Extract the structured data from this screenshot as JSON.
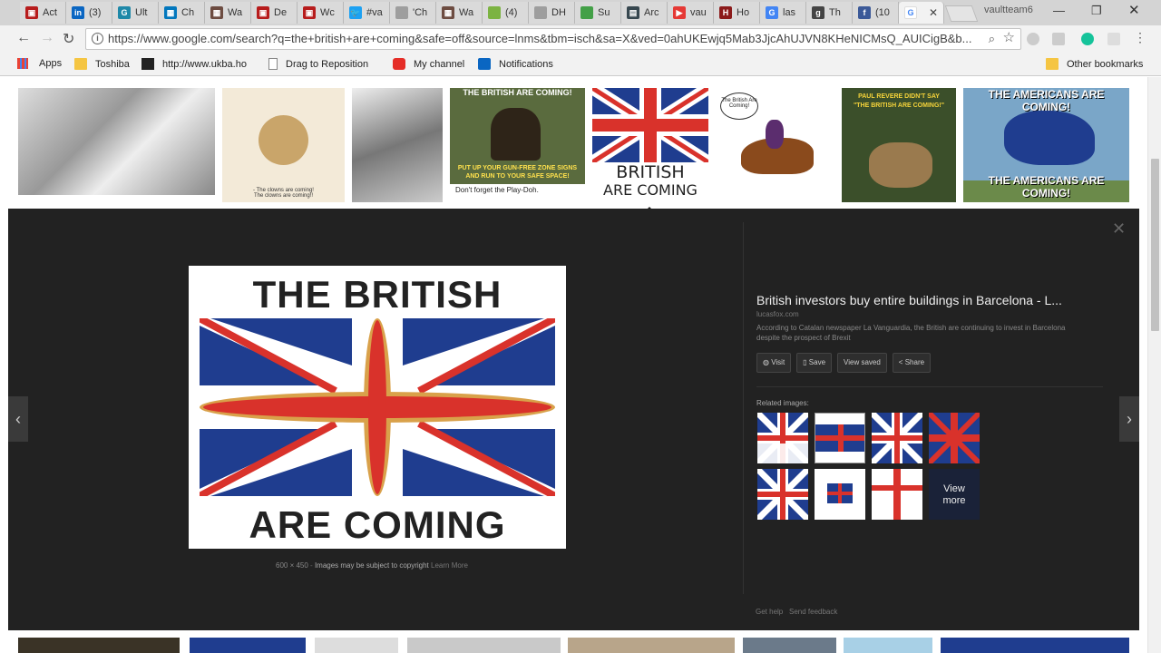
{
  "browser": {
    "tabs": [
      {
        "label": "Act",
        "color": "#b71c1c",
        "glyph": "▣"
      },
      {
        "label": "(3)",
        "color": "#0a66c2",
        "glyph": "in"
      },
      {
        "label": "Ult",
        "color": "#1e88a8",
        "glyph": "G"
      },
      {
        "label": "Ch",
        "color": "#0277bd",
        "glyph": "▦"
      },
      {
        "label": "Wa",
        "color": "#6d4c41",
        "glyph": "▦"
      },
      {
        "label": "De",
        "color": "#b71c1c",
        "glyph": "▣"
      },
      {
        "label": "Wc",
        "color": "#b71c1c",
        "glyph": "▣"
      },
      {
        "label": "#va",
        "color": "#1da1f2",
        "glyph": "🐦"
      },
      {
        "label": "'Ch",
        "color": "#9e9e9e",
        "glyph": ""
      },
      {
        "label": "Wa",
        "color": "#6d4c41",
        "glyph": "▦"
      },
      {
        "label": "(4)",
        "color": "#7cb342",
        "glyph": ""
      },
      {
        "label": "DH",
        "color": "#9e9e9e",
        "glyph": ""
      },
      {
        "label": "Su",
        "color": "#43a047",
        "glyph": ""
      },
      {
        "label": "Arc",
        "color": "#37474f",
        "glyph": "▤"
      },
      {
        "label": "vau",
        "color": "#e53935",
        "glyph": "▶"
      },
      {
        "label": "Ho",
        "color": "#8b1a1a",
        "glyph": "H"
      },
      {
        "label": "las",
        "color": "#4285f4",
        "glyph": "G"
      },
      {
        "label": "Th",
        "color": "#444444",
        "glyph": "g"
      },
      {
        "label": "(10",
        "color": "#3b5998",
        "glyph": "f"
      }
    ],
    "active_tab": {
      "label": "",
      "glyph": "G"
    },
    "profile": "vaultteam6",
    "url": "https://www.google.com/search?q=the+british+are+coming&safe=off&source=lnms&tbm=isch&sa=X&ved=0ahUKEwjq5Mab3JjcAhUJVN8KHeNICMsQ_AUICigB&b...",
    "bookmarks": {
      "apps": "Apps",
      "toshiba": "Toshiba",
      "ukba": "http://www.ukba.ho",
      "drag": "Drag to Reposition",
      "channel": "My channel",
      "notifications": "Notifications",
      "other": "Other bookmarks"
    }
  },
  "thumbs_top": {
    "british_coming_meme": [
      "THE BRITISH ARE COMING!",
      "PUT UP YOUR GUN-FREE ZONE SIGNS",
      "AND RUN TO YOUR SAFE SPACE!",
      "Don't forget the Play-Doh."
    ],
    "flag_caption": [
      "BRITISH",
      "ARE COMING"
    ],
    "cartoon_bubble": "The British Are Coming!",
    "clowns_caption": "- The clowns are coming!\nThe clowns are coming!!",
    "paul_revere": [
      "PAUL REVERE DIDN'T SAY",
      "\"THE BRITISH ARE COMING!\""
    ],
    "americans": [
      "THE AMERICANS ARE COMING!",
      "THE AMERICANS ARE COMING!"
    ]
  },
  "preview": {
    "image_top_text": "THE BRITISH",
    "image_bottom_text": "ARE COMING",
    "size": "600 × 450",
    "copyright": "Images may be subject to copyright",
    "learn_more": "Learn More",
    "title": "British investors buy entire buildings in Barcelona - L...",
    "domain": "lucasfox.com",
    "description": "According to Catalan newspaper La Vanguardia, the British are continuing to invest in Barcelona despite the prospect of Brexit",
    "buttons": {
      "visit": "Visit",
      "save": "Save",
      "view_saved": "View saved",
      "share": "Share"
    },
    "related_heading": "Related images:",
    "view_more": "View more",
    "get_help": "Get help",
    "send_feedback": "Send feedback"
  },
  "colors": {
    "flag_blue": "#1f3d8f",
    "flag_red": "#d9322b",
    "flag_gold": "#d9a14a",
    "panel_bg": "#222222"
  }
}
